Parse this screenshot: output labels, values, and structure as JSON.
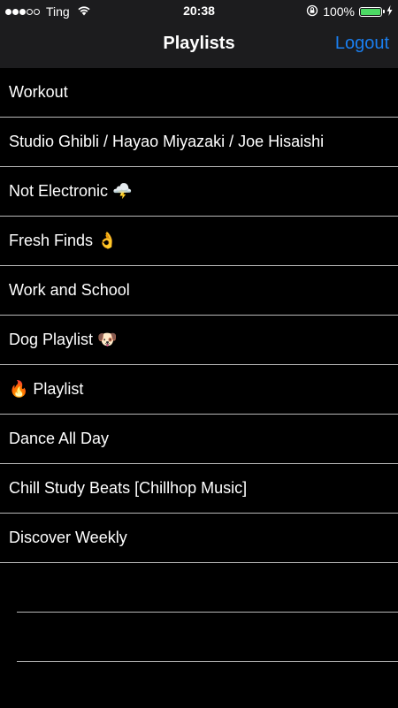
{
  "status_bar": {
    "carrier": "Ting",
    "signal_strength": 3,
    "signal_max": 5,
    "time": "20:38",
    "battery_percent": "100%",
    "battery_level": 1.0,
    "icons": [
      "wifi-icon",
      "orientation-lock-icon",
      "battery-icon",
      "charging-bolt-icon"
    ]
  },
  "nav": {
    "title": "Playlists",
    "logout_label": "Logout"
  },
  "playlists": [
    "Workout",
    "Studio Ghibli / Hayao Miyazaki / Joe Hisaishi",
    "Not Electronic 🌩️",
    "Fresh Finds 👌",
    "Work and School",
    "Dog Playlist 🐶",
    "🔥 Playlist",
    "Dance All Day",
    "Chill Study Beats [Chillhop Music]",
    "Discover Weekly"
  ],
  "colors": {
    "accent": "#1a7ff0",
    "background": "#000000",
    "bar_background": "#1c1c1e",
    "separator": "#b9b9b9",
    "battery": "#4cd964"
  }
}
